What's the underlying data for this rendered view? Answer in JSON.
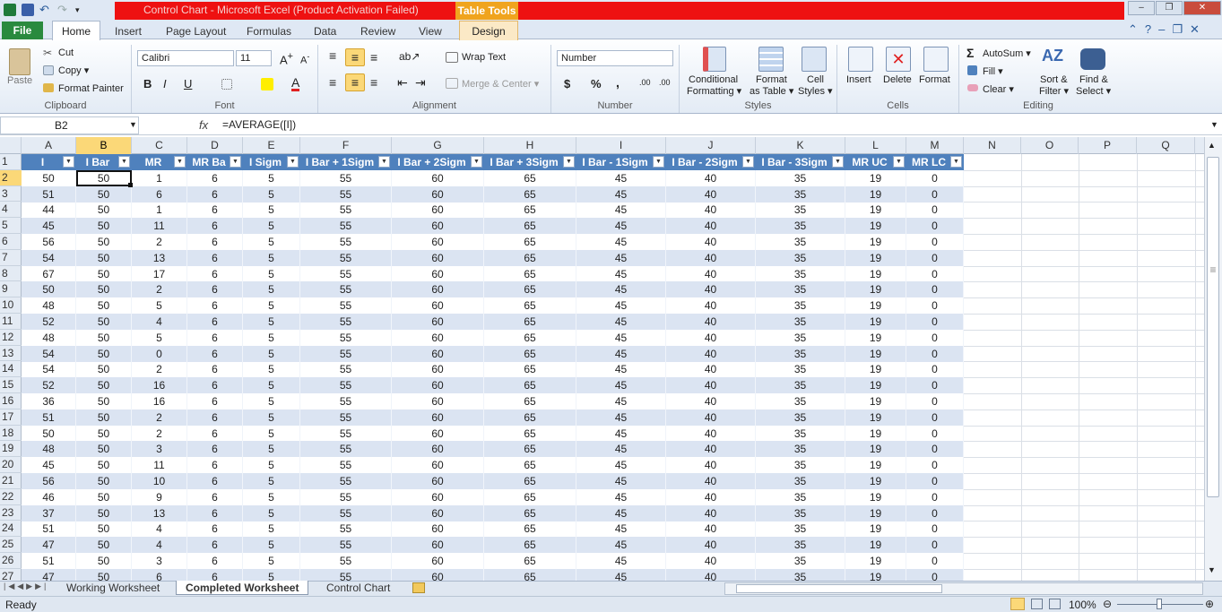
{
  "window": {
    "title": "Control Chart  -  Microsoft Excel (Product Activation Failed)",
    "context_tab": "Table Tools",
    "controls": {
      "minimize": "–",
      "restore": "❐",
      "close": "✕"
    }
  },
  "ribbon_tabs": {
    "file": "File",
    "home": "Home",
    "insert": "Insert",
    "page_layout": "Page Layout",
    "formulas": "Formulas",
    "data": "Data",
    "review": "Review",
    "view": "View",
    "design": "Design"
  },
  "clipboard": {
    "paste": "Paste",
    "cut": "Cut",
    "copy": "Copy ▾",
    "format_painter": "Format Painter",
    "label": "Clipboard"
  },
  "font": {
    "name": "Calibri",
    "size": "11",
    "bold": "B",
    "italic": "I",
    "underline": "U",
    "label": "Font"
  },
  "alignment": {
    "wrap_text": "Wrap Text",
    "merge_center": "Merge & Center ▾",
    "label": "Alignment"
  },
  "number": {
    "format": "Number",
    "currency": "$",
    "percent": "%",
    "comma": ",",
    "inc_decimal": ".00",
    "dec_decimal": ".00",
    "label": "Number"
  },
  "styles": {
    "conditional": "Conditional",
    "formatting": "Formatting ▾",
    "format": "Format",
    "as_table": "as Table ▾",
    "cell": "Cell",
    "cell_styles": "Styles ▾",
    "label": "Styles"
  },
  "cells": {
    "insert": "Insert",
    "delete": "Delete",
    "format": "Format",
    "label": "Cells"
  },
  "editing": {
    "autosum": "AutoSum ▾",
    "fill": "Fill ▾",
    "clear": "Clear ▾",
    "sort_filter_1": "Sort &",
    "sort_filter_2": "Filter ▾",
    "find_select_1": "Find &",
    "find_select_2": "Select ▾",
    "label": "Editing"
  },
  "formula_bar": {
    "name_box": "B2",
    "fx": "fx",
    "formula": "=AVERAGE([I])"
  },
  "columns": [
    "A",
    "B",
    "C",
    "D",
    "E",
    "F",
    "G",
    "H",
    "I",
    "J",
    "K",
    "L",
    "M",
    "N",
    "O",
    "P",
    "Q"
  ],
  "rows": [
    "1",
    "2",
    "3",
    "4",
    "5",
    "6",
    "7",
    "8",
    "9",
    "10",
    "11",
    "12",
    "13",
    "14",
    "15",
    "16",
    "17",
    "18",
    "19",
    "20",
    "21",
    "22",
    "23",
    "24",
    "25",
    "26",
    "27"
  ],
  "table_headers": [
    "I",
    "I Bar",
    "MR",
    "MR Ba",
    "I Sigm",
    "I Bar + 1Sigm",
    "I Bar + 2Sigm",
    "I Bar + 3Sigm",
    "I Bar - 1Sigm",
    "I Bar - 2Sigm",
    "I Bar - 3Sigm",
    "MR UC",
    "MR LC"
  ],
  "table_rows": [
    [
      "50",
      "50",
      "1",
      "6",
      "5",
      "55",
      "60",
      "65",
      "45",
      "40",
      "35",
      "19",
      "0"
    ],
    [
      "51",
      "50",
      "6",
      "6",
      "5",
      "55",
      "60",
      "65",
      "45",
      "40",
      "35",
      "19",
      "0"
    ],
    [
      "44",
      "50",
      "1",
      "6",
      "5",
      "55",
      "60",
      "65",
      "45",
      "40",
      "35",
      "19",
      "0"
    ],
    [
      "45",
      "50",
      "11",
      "6",
      "5",
      "55",
      "60",
      "65",
      "45",
      "40",
      "35",
      "19",
      "0"
    ],
    [
      "56",
      "50",
      "2",
      "6",
      "5",
      "55",
      "60",
      "65",
      "45",
      "40",
      "35",
      "19",
      "0"
    ],
    [
      "54",
      "50",
      "13",
      "6",
      "5",
      "55",
      "60",
      "65",
      "45",
      "40",
      "35",
      "19",
      "0"
    ],
    [
      "67",
      "50",
      "17",
      "6",
      "5",
      "55",
      "60",
      "65",
      "45",
      "40",
      "35",
      "19",
      "0"
    ],
    [
      "50",
      "50",
      "2",
      "6",
      "5",
      "55",
      "60",
      "65",
      "45",
      "40",
      "35",
      "19",
      "0"
    ],
    [
      "48",
      "50",
      "5",
      "6",
      "5",
      "55",
      "60",
      "65",
      "45",
      "40",
      "35",
      "19",
      "0"
    ],
    [
      "52",
      "50",
      "4",
      "6",
      "5",
      "55",
      "60",
      "65",
      "45",
      "40",
      "35",
      "19",
      "0"
    ],
    [
      "48",
      "50",
      "5",
      "6",
      "5",
      "55",
      "60",
      "65",
      "45",
      "40",
      "35",
      "19",
      "0"
    ],
    [
      "54",
      "50",
      "0",
      "6",
      "5",
      "55",
      "60",
      "65",
      "45",
      "40",
      "35",
      "19",
      "0"
    ],
    [
      "54",
      "50",
      "2",
      "6",
      "5",
      "55",
      "60",
      "65",
      "45",
      "40",
      "35",
      "19",
      "0"
    ],
    [
      "52",
      "50",
      "16",
      "6",
      "5",
      "55",
      "60",
      "65",
      "45",
      "40",
      "35",
      "19",
      "0"
    ],
    [
      "36",
      "50",
      "16",
      "6",
      "5",
      "55",
      "60",
      "65",
      "45",
      "40",
      "35",
      "19",
      "0"
    ],
    [
      "51",
      "50",
      "2",
      "6",
      "5",
      "55",
      "60",
      "65",
      "45",
      "40",
      "35",
      "19",
      "0"
    ],
    [
      "50",
      "50",
      "2",
      "6",
      "5",
      "55",
      "60",
      "65",
      "45",
      "40",
      "35",
      "19",
      "0"
    ],
    [
      "48",
      "50",
      "3",
      "6",
      "5",
      "55",
      "60",
      "65",
      "45",
      "40",
      "35",
      "19",
      "0"
    ],
    [
      "45",
      "50",
      "11",
      "6",
      "5",
      "55",
      "60",
      "65",
      "45",
      "40",
      "35",
      "19",
      "0"
    ],
    [
      "56",
      "50",
      "10",
      "6",
      "5",
      "55",
      "60",
      "65",
      "45",
      "40",
      "35",
      "19",
      "0"
    ],
    [
      "46",
      "50",
      "9",
      "6",
      "5",
      "55",
      "60",
      "65",
      "45",
      "40",
      "35",
      "19",
      "0"
    ],
    [
      "37",
      "50",
      "13",
      "6",
      "5",
      "55",
      "60",
      "65",
      "45",
      "40",
      "35",
      "19",
      "0"
    ],
    [
      "51",
      "50",
      "4",
      "6",
      "5",
      "55",
      "60",
      "65",
      "45",
      "40",
      "35",
      "19",
      "0"
    ],
    [
      "47",
      "50",
      "4",
      "6",
      "5",
      "55",
      "60",
      "65",
      "45",
      "40",
      "35",
      "19",
      "0"
    ],
    [
      "51",
      "50",
      "3",
      "6",
      "5",
      "55",
      "60",
      "65",
      "45",
      "40",
      "35",
      "19",
      "0"
    ],
    [
      "47",
      "50",
      "6",
      "6",
      "5",
      "55",
      "60",
      "65",
      "45",
      "40",
      "35",
      "19",
      "0"
    ]
  ],
  "sheets": {
    "tab1": "Working Worksheet",
    "tab2": "Completed Worksheet",
    "tab3": "Control Chart"
  },
  "status": {
    "ready": "Ready",
    "zoom": "100%"
  },
  "colors": {
    "accent_red": "#ee1111",
    "table_header": "#4f81bd",
    "band": "#dbe4f2",
    "file_tab": "#2a8a3e",
    "selection": "#fbd878"
  }
}
